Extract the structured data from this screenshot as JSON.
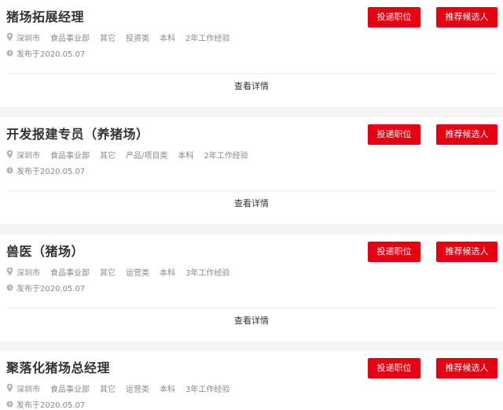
{
  "jobs": [
    {
      "title": "猪场拓展经理",
      "apply_label": "投递职位",
      "recommend_label": "推荐候选人",
      "location": "深圳市",
      "department": "食品事业部",
      "category": "其它",
      "job_type": "投资类",
      "education": "本科",
      "experience": "2年工作经验",
      "published": "发布于2020.05.07",
      "details_label": "查看详情"
    },
    {
      "title": "开发报建专员（养猪场）",
      "apply_label": "投递职位",
      "recommend_label": "推荐候选人",
      "location": "深圳市",
      "department": "食品事业部",
      "category": "其它",
      "job_type": "产品/项目类",
      "education": "本科",
      "experience": "2年工作经验",
      "published": "发布于2020.05.07",
      "details_label": "查看详情"
    },
    {
      "title": "兽医（猪场）",
      "apply_label": "投递职位",
      "recommend_label": "推荐候选人",
      "location": "深圳市",
      "department": "食品事业部",
      "category": "其它",
      "job_type": "运营类",
      "education": "本科",
      "experience": "3年工作经验",
      "published": "发布于2020.05.07",
      "details_label": "查看详情"
    },
    {
      "title": "聚落化猪场总经理",
      "apply_label": "投递职位",
      "recommend_label": "推荐候选人",
      "location": "深圳市",
      "department": "食品事业部",
      "category": "其它",
      "job_type": "运营类",
      "education": "本科",
      "experience": "3年工作经验",
      "published": "发布于2020.05.07"
    }
  ],
  "icons": {
    "location": "location-pin-icon",
    "date": "clock-icon"
  },
  "colors": {
    "accent": "#e60012",
    "separator": "#f4f4f4",
    "meta_text": "#888888"
  }
}
